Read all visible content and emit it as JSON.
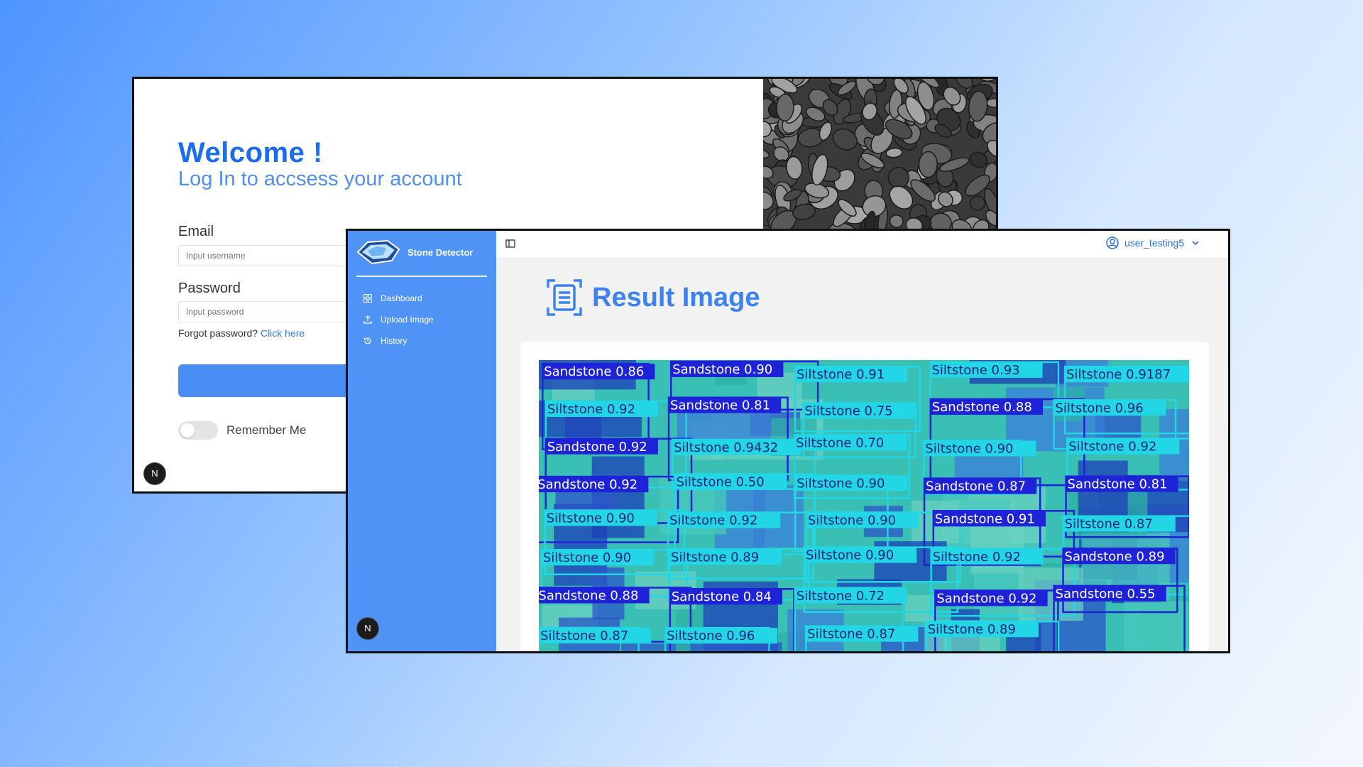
{
  "login": {
    "heading": "Welcome !",
    "subheading": "Log In to accsess your account",
    "email_label": "Email",
    "email_placeholder": "Input username",
    "password_label": "Password",
    "password_placeholder": "Input password",
    "forgot_text": "Forgot password?",
    "forgot_link": "Click here",
    "remember_label": "Remember Me",
    "remember_on": false,
    "badge": "N"
  },
  "dashboard": {
    "brand": "Stone Detector",
    "nav": [
      {
        "label": "Dashboard",
        "icon": "grid-icon"
      },
      {
        "label": "Upload Image",
        "icon": "upload-icon"
      },
      {
        "label": "History",
        "icon": "history-icon"
      }
    ],
    "user": "user_testing5",
    "title": "Result Image",
    "badge": "N",
    "detections": [
      "Sandstone 0.86",
      "Sandstone 0.90",
      "Siltstone 0.91",
      "Siltstone 0.93",
      "Siltstone 0.9187",
      "Siltstone 0.92",
      "Sandstone 0.81",
      "Siltstone 0.75",
      "Sandstone 0.88",
      "Siltstone 0.96",
      "Sandstone 0.92",
      "Siltstone 0.9432",
      "Siltstone 0.70",
      "Siltstone 0.90",
      "Siltstone 0.92",
      "Sandstone 0.92",
      "Siltstone 0.50",
      "Siltstone 0.90",
      "Sandstone 0.87",
      "Sandstone 0.81",
      "Siltstone 0.90",
      "Siltstone 0.92",
      "Siltstone 0.90",
      "Sandstone 0.91",
      "Siltstone 0.87",
      "Siltstone 0.90",
      "Siltstone 0.89",
      "Siltstone 0.90",
      "Siltstone 0.92",
      "Sandstone 0.89",
      "Sandstone 0.88",
      "Sandstone 0.84",
      "Siltstone 0.72",
      "Sandstone 0.92",
      "Sandstone 0.55",
      "Siltstone 0.87",
      "Siltstone 0.96",
      "Siltstone 0.87",
      "Siltstone 0.89"
    ]
  },
  "colors": {
    "accent": "#1a6cf0",
    "sidebar": "#4f93f7",
    "sandstone_box": "#1f23d8",
    "siltstone_box": "#22d6e6"
  }
}
